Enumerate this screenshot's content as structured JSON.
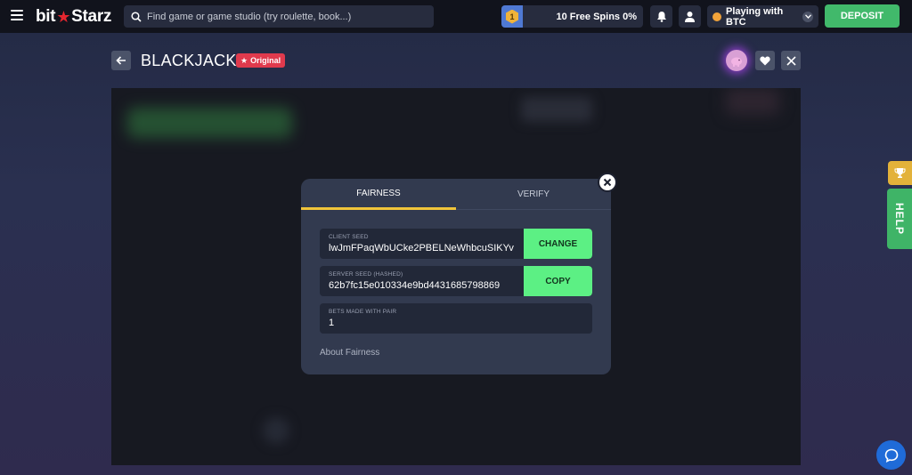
{
  "topbar": {
    "logo_left": "bit",
    "logo_right": "Starz",
    "search_placeholder": "Find game or game studio (try roulette, book...)",
    "level": "1",
    "free_spins": "10 Free Spins 0%",
    "currency_label": "Playing with BTC",
    "deposit_label": "DEPOSIT"
  },
  "game": {
    "title": "BLACKJACK",
    "badge": "Original"
  },
  "modal": {
    "tabs": [
      {
        "label": "FAIRNESS",
        "active": true
      },
      {
        "label": "VERIFY",
        "active": false
      }
    ],
    "client_seed": {
      "label": "CLIENT SEED",
      "value": "lwJmFPaqWbUCke2PBELNeWhbcuSIKYv",
      "action": "CHANGE"
    },
    "server_seed": {
      "label": "SERVER SEED (HASHED)",
      "value": "62b7fc15e010334e9bd4431685798869",
      "action": "COPY"
    },
    "bets": {
      "label": "BETS MADE WITH PAIR",
      "value": "1"
    },
    "about_link": "About Fairness"
  },
  "side": {
    "help_label": "HELP"
  },
  "colors": {
    "accent_green": "#5cf084",
    "deposit_green": "#41b96b",
    "tab_underline": "#f0c43a",
    "badge_red": "#e03a4d"
  }
}
